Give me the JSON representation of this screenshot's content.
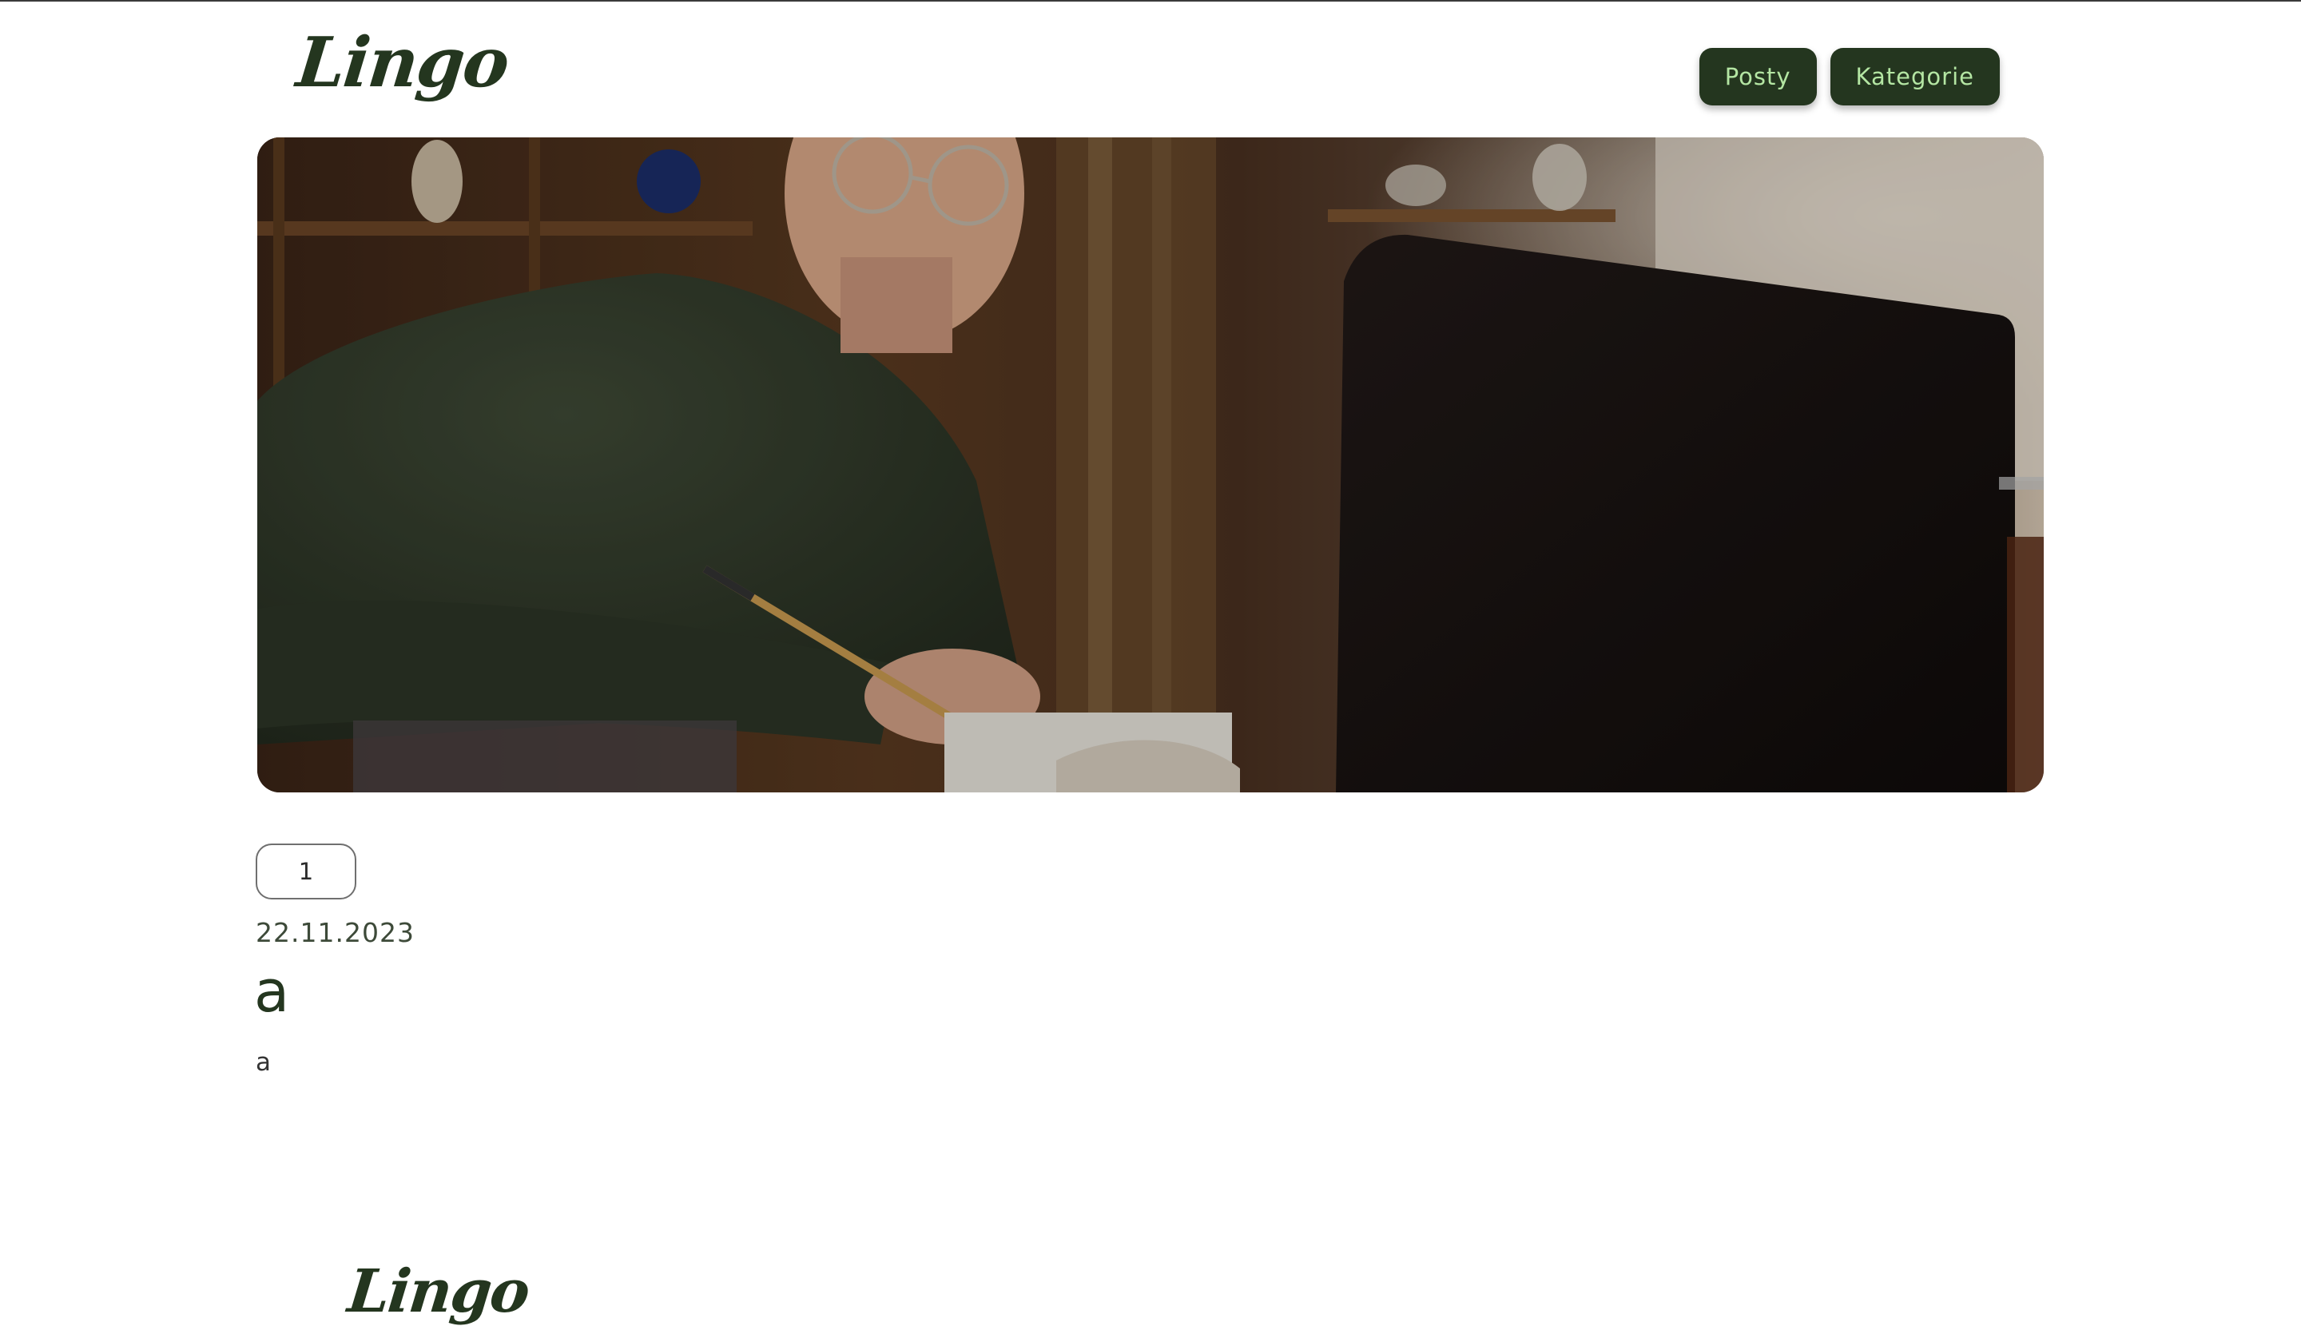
{
  "header": {
    "logo": "Lingo",
    "nav": [
      {
        "label": "Posty"
      },
      {
        "label": "Kategorie"
      }
    ]
  },
  "hero": {
    "image_description": "hero-photo"
  },
  "post": {
    "badge": "1",
    "date": "22.11.2023",
    "title": "a",
    "body": "a"
  },
  "footer": {
    "logo": "Lingo"
  },
  "colors": {
    "brand_dark_green": "#24361f",
    "nav_text": "#b4e6a3",
    "background": "#ffffff"
  }
}
